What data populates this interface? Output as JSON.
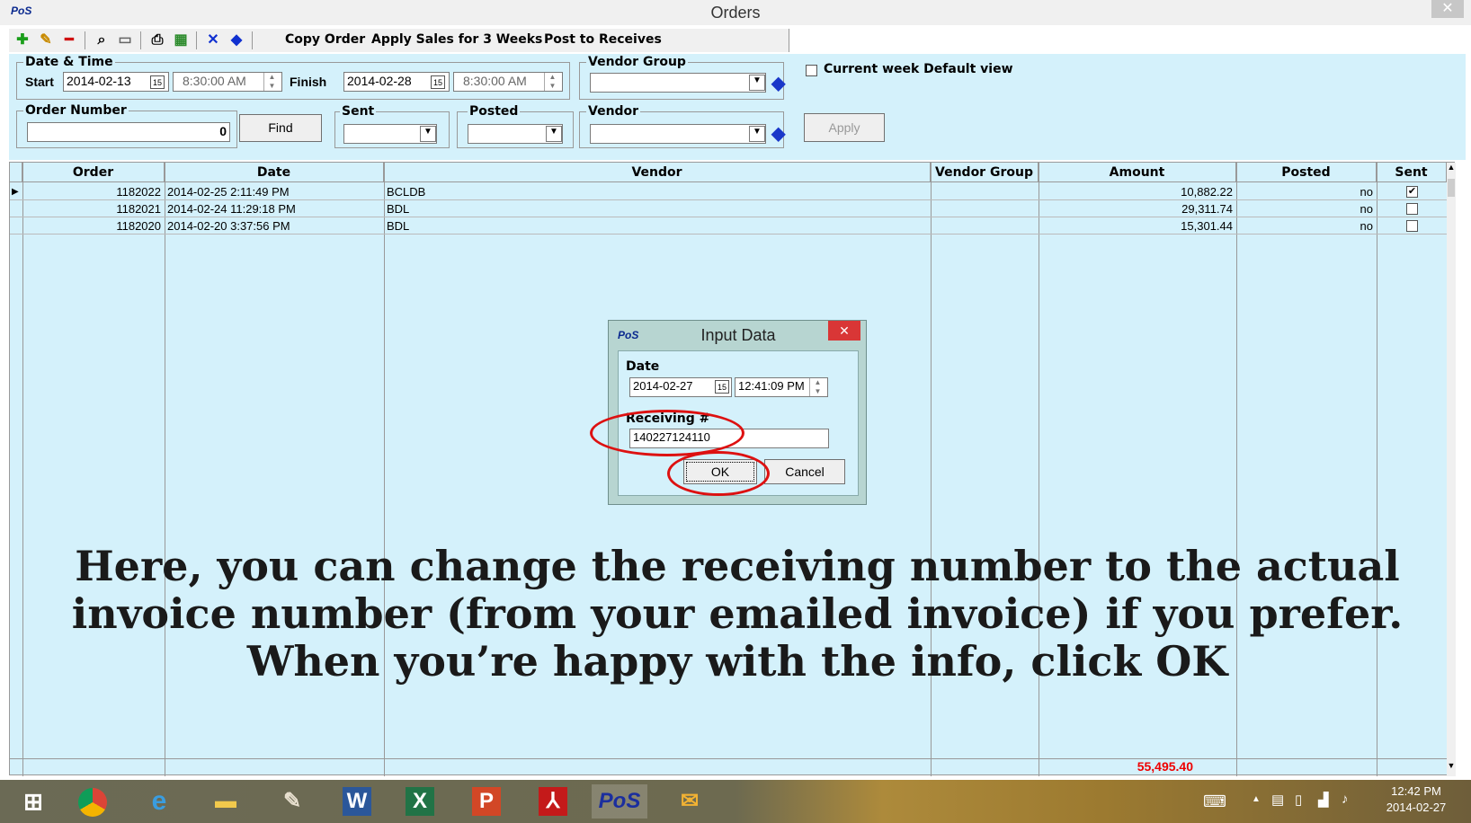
{
  "window": {
    "title": "Orders",
    "logo": "PoS",
    "close": "✕"
  },
  "toolbar": {
    "icons": [
      "add-icon",
      "edit-icon",
      "remove-icon",
      "preview-icon",
      "window-icon",
      "print-icon",
      "export-icon",
      "delete-icon",
      "tag-icon"
    ],
    "copy_order": "Copy Order",
    "apply_sales": "Apply Sales for 3 Weeks",
    "post_receives": "Post to Receives"
  },
  "filters": {
    "date_time_label": "Date & Time",
    "start_label": "Start",
    "start_date": "2014-02-13",
    "start_time": "8:30:00 AM",
    "finish_label": "Finish",
    "finish_date": "2014-02-28",
    "finish_time": "8:30:00 AM",
    "vendor_group_label": "Vendor Group",
    "current_week_label": "Current week Default view",
    "order_number_label": "Order Number",
    "order_number_value": "0",
    "find_label": "Find",
    "sent_label": "Sent",
    "posted_label": "Posted",
    "vendor_label": "Vendor",
    "apply_label": "Apply",
    "calendar_glyph": "15"
  },
  "grid": {
    "columns": [
      "Order",
      "Date",
      "Vendor",
      "Vendor Group",
      "Amount",
      "Posted",
      "Sent"
    ],
    "rows": [
      {
        "order": "1182022",
        "date": "2014-02-25 2:11:49 PM",
        "vendor": "BCLDB",
        "group": "",
        "amount": "10,882.22",
        "posted": "no",
        "sent": "✔"
      },
      {
        "order": "1182021",
        "date": "2014-02-24 11:29:18 PM",
        "vendor": "BDL",
        "group": "",
        "amount": "29,311.74",
        "posted": "no",
        "sent": ""
      },
      {
        "order": "1182020",
        "date": "2014-02-20 3:37:56 PM",
        "vendor": "BDL",
        "group": "",
        "amount": "15,301.44",
        "posted": "no",
        "sent": ""
      }
    ],
    "total": "55,495.40"
  },
  "dialog": {
    "title": "Input Data",
    "logo": "PoS",
    "close": "✕",
    "date_label": "Date",
    "date_value": "2014-02-27",
    "time_value": "12:41:09 PM",
    "receiving_label": "Receiving #",
    "receiving_value": "140227124110",
    "ok_label": "OK",
    "cancel_label": "Cancel"
  },
  "caption": {
    "line1": "Here, you can change the receiving number to the actual",
    "line2": "invoice number (from your emailed invoice) if you prefer.",
    "line3": "When you’re happy with the info, click OK"
  },
  "taskbar": {
    "apps": [
      "windows-start-icon",
      "chrome-icon",
      "internet-explorer-icon",
      "file-explorer-icon",
      "paint-icon",
      "word-icon",
      "excel-icon",
      "powerpoint-icon",
      "acrobat-icon",
      "pos-app-icon",
      "mail-icon"
    ],
    "pos_label": "PoS",
    "clock_time": "12:42 PM",
    "clock_date": "2014-02-27"
  },
  "colors": {
    "panel": "#d4f1fb",
    "dialog_frame": "#b7d5d1",
    "annotation": "#dd1111",
    "total": "#ee0000"
  }
}
